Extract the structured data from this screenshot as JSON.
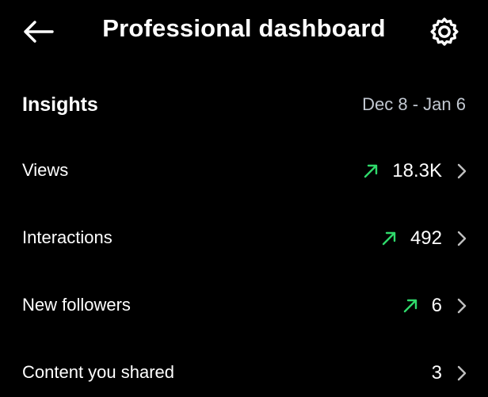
{
  "header": {
    "title": "Professional dashboard",
    "back_icon": "arrow-left-icon",
    "settings_icon": "gear-icon"
  },
  "insights": {
    "title": "Insights",
    "date_range": "Dec 8 - Jan 6"
  },
  "rows": [
    {
      "label": "Views",
      "value": "18.3K",
      "trend": "up"
    },
    {
      "label": "Interactions",
      "value": "492",
      "trend": "up"
    },
    {
      "label": "New followers",
      "value": "6",
      "trend": "up"
    },
    {
      "label": "Content you shared",
      "value": "3",
      "trend": "none"
    }
  ],
  "colors": {
    "background": "#000000",
    "text": "#ffffff",
    "date_text": "#c2c8d1",
    "trend_up": "#2fd96b",
    "chevron": "#bfbfbf"
  }
}
